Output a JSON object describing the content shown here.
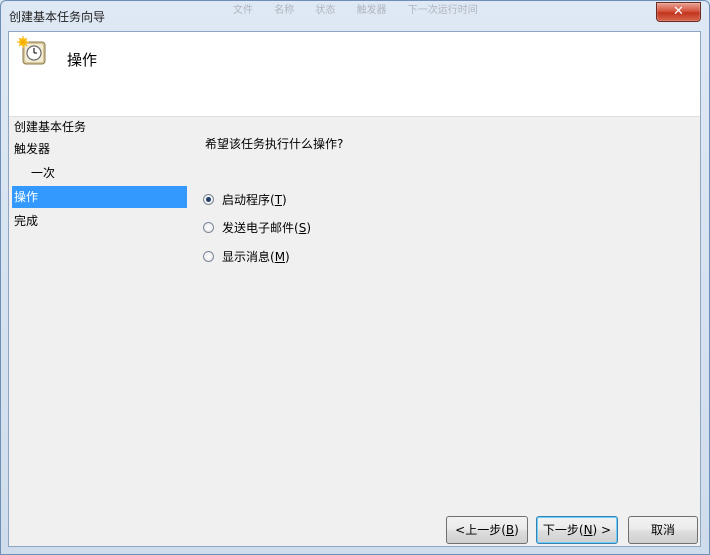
{
  "window": {
    "title": "创建基本任务向导"
  },
  "background_window": {
    "text_fragments": [
      "文件",
      "名称",
      "状态",
      "触发器",
      "下一次运行时间"
    ]
  },
  "header": {
    "title": "操作",
    "icon": "task-clock-icon"
  },
  "nav": {
    "items": [
      {
        "label": "创建基本任务",
        "selected": false,
        "indent": 0
      },
      {
        "label": "触发器",
        "selected": false,
        "indent": 0
      },
      {
        "label": "一次",
        "selected": false,
        "indent": 1
      },
      {
        "label": "操作",
        "selected": true,
        "indent": 0
      },
      {
        "label": "完成",
        "selected": false,
        "indent": 0
      }
    ]
  },
  "main": {
    "question": "希望该任务执行什么操作?",
    "options": [
      {
        "label": "启动程序(",
        "key": "T",
        "suffix": ")",
        "checked": true
      },
      {
        "label": "发送电子邮件(",
        "key": "S",
        "suffix": ")",
        "checked": false
      },
      {
        "label": "显示消息(",
        "key": "M",
        "suffix": ")",
        "checked": false
      }
    ]
  },
  "buttons": {
    "back": {
      "prefix": "<上一步(",
      "key": "B",
      "suffix": ")"
    },
    "next": {
      "prefix": "下一步(",
      "key": "N",
      "suffix": ") >"
    },
    "cancel": {
      "label": "取消"
    }
  },
  "colors": {
    "selection": "#3399ff",
    "close": "#c2351f"
  }
}
